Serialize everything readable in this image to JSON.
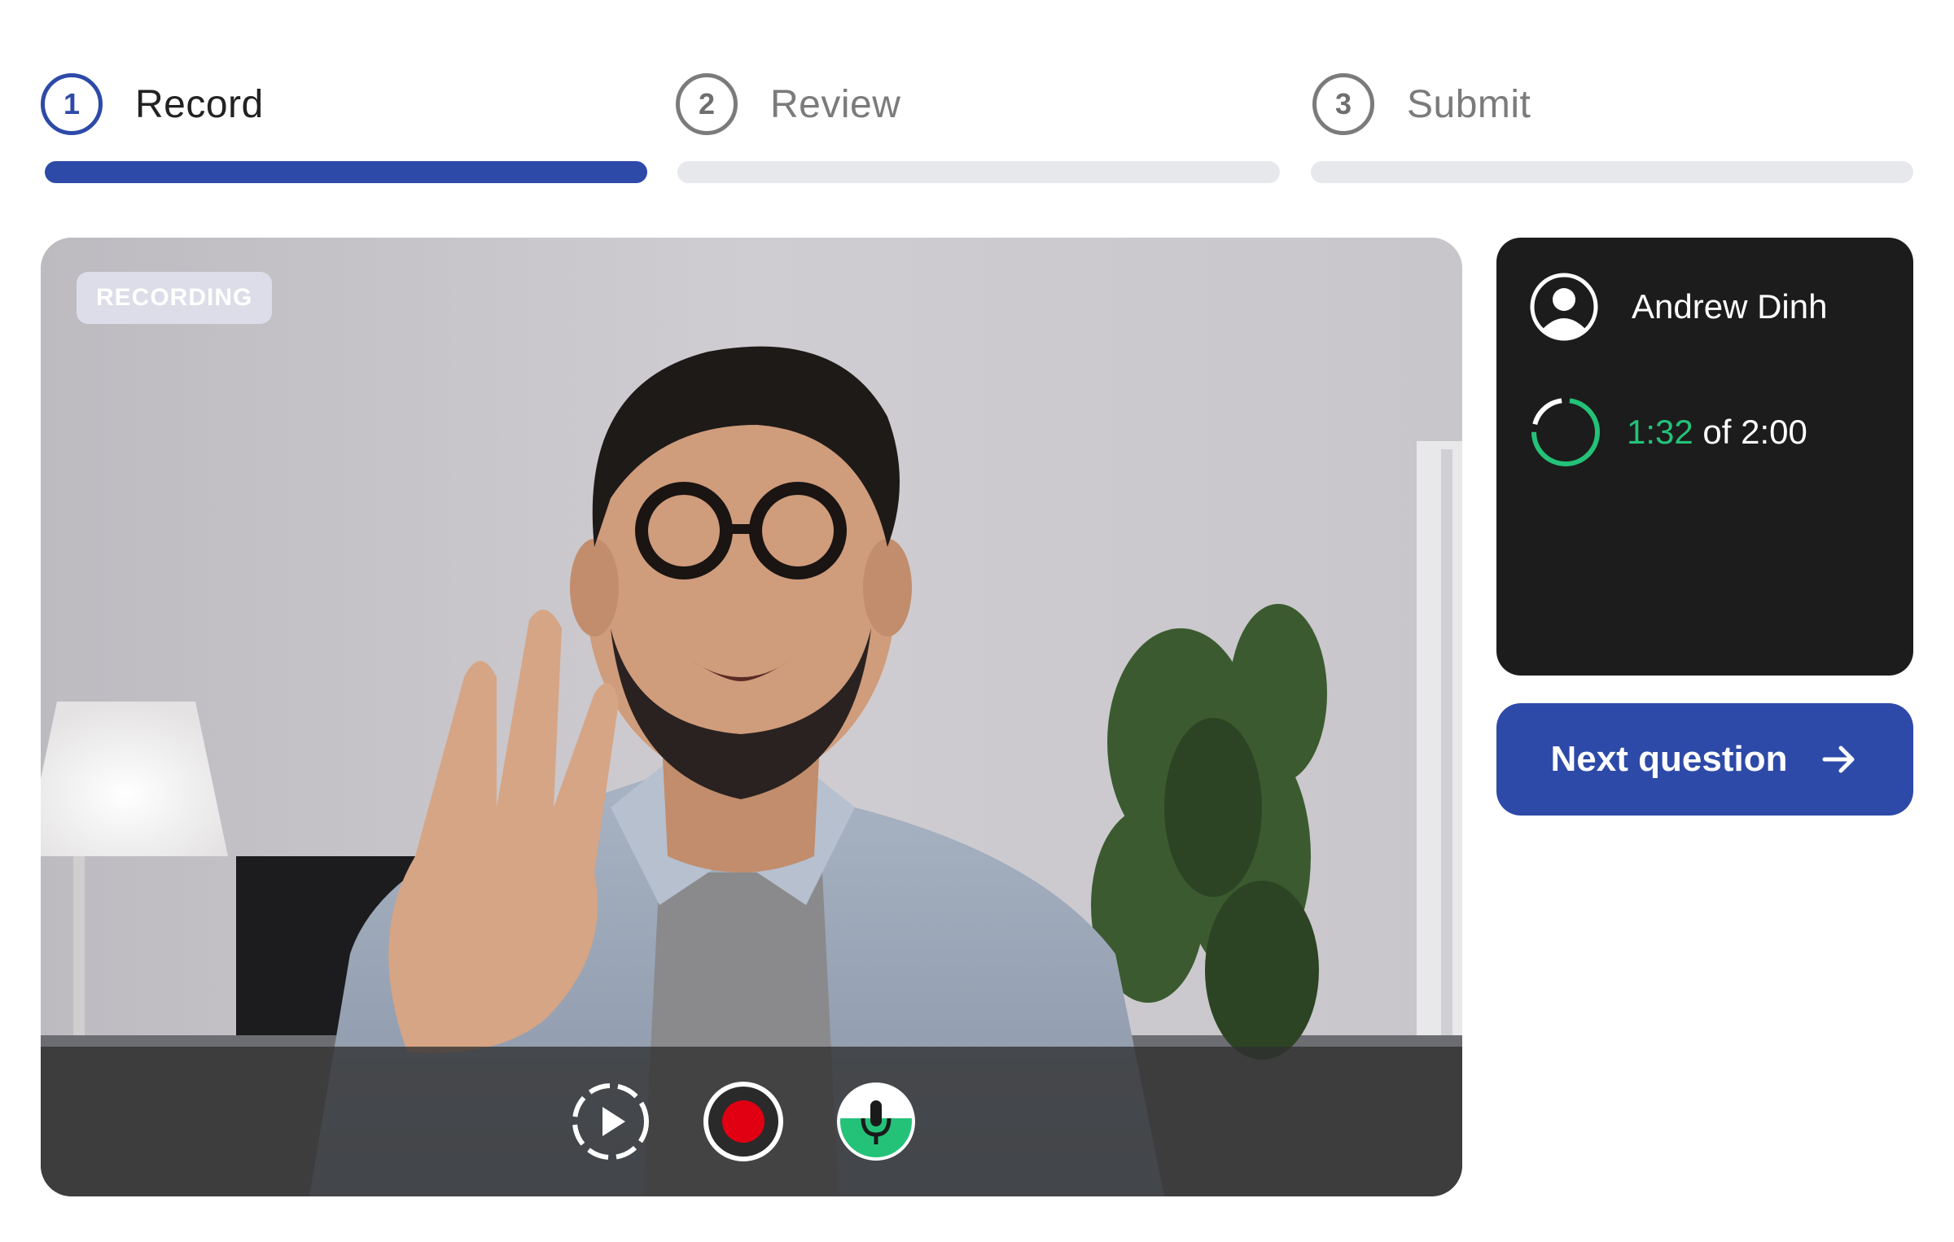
{
  "stepper": {
    "steps": [
      {
        "number": "1",
        "label": "Record",
        "active": true
      },
      {
        "number": "2",
        "label": "Review",
        "active": false
      },
      {
        "number": "3",
        "label": "Submit",
        "active": false
      }
    ]
  },
  "video": {
    "badge": "RECORDING",
    "controls": [
      {
        "icon": "replay-play-icon"
      },
      {
        "icon": "record-icon"
      },
      {
        "icon": "microphone-icon"
      }
    ]
  },
  "panel": {
    "user_name": "Andrew Dinh",
    "user_icon": "user-avatar-icon",
    "timer": {
      "elapsed": "1:32",
      "separator": "of",
      "total": "2:00",
      "progress": 0.77,
      "color": "#24c279"
    }
  },
  "next_button": {
    "label": "Next question",
    "icon": "arrow-right-icon"
  },
  "colors": {
    "accent": "#2e4aa8",
    "timer_green": "#24c279",
    "record_red": "#e00012",
    "panel_bg": "#1c1c1c"
  }
}
